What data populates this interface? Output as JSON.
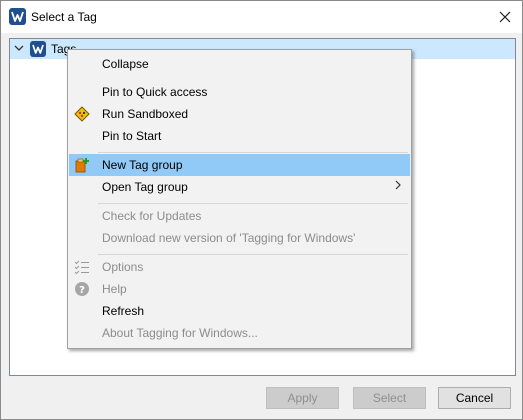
{
  "window": {
    "title": "Select a Tag",
    "close_icon": "close-icon"
  },
  "tree": {
    "root_label": "Tags",
    "expand_icon": "chevron-down-icon",
    "node_icon": "tagging-logo-icon"
  },
  "context_menu": {
    "items": [
      {
        "label": "Collapse",
        "enabled": true
      },
      {
        "label": "Pin to Quick access",
        "enabled": true
      },
      {
        "label": "Run Sandboxed",
        "enabled": true,
        "icon": "sandbox-icon"
      },
      {
        "label": "Pin to Start",
        "enabled": true
      },
      {
        "label": "New Tag group",
        "enabled": true,
        "icon": "new-tag-group-icon",
        "highlighted": true
      },
      {
        "label": "Open Tag group",
        "enabled": true,
        "submenu": true
      },
      {
        "label": "Check for Updates",
        "enabled": false
      },
      {
        "label": "Download new version of 'Tagging for Windows'",
        "enabled": false
      },
      {
        "label": "Options",
        "enabled": false,
        "icon": "options-list-icon"
      },
      {
        "label": "Help",
        "enabled": false,
        "icon": "help-icon"
      },
      {
        "label": "Refresh",
        "enabled": true
      },
      {
        "label": "About Tagging for Windows...",
        "enabled": false
      }
    ]
  },
  "buttons": {
    "apply": {
      "label": "Apply",
      "enabled": false
    },
    "select": {
      "label": "Select",
      "enabled": false
    },
    "cancel": {
      "label": "Cancel",
      "enabled": true
    }
  },
  "colors": {
    "highlight": "#91c9f7",
    "tree_selection": "#cce8ff",
    "accent_logo": "#1f4f8f"
  }
}
